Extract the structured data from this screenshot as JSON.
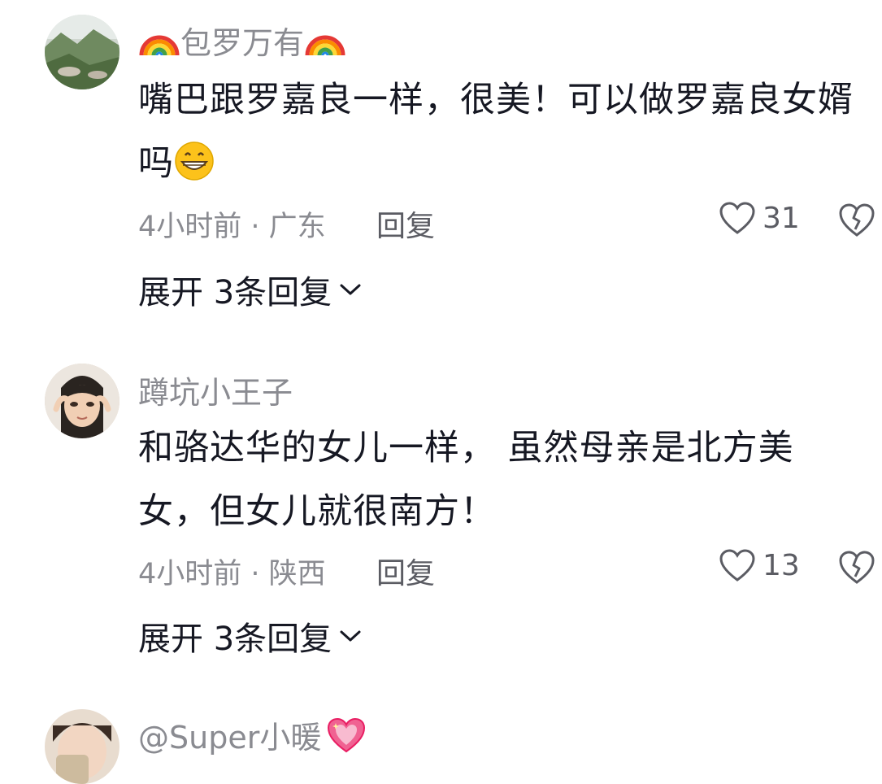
{
  "comments": [
    {
      "username": "包罗万有",
      "username_emoji": "rainbow-icon",
      "text": "嘴巴跟罗嘉良一样，很美！可以做罗嘉良女婿吗",
      "text_emoji": "grinning-face-icon",
      "time_location": "4小时前 · 广东",
      "reply_label": "回复",
      "like_count": "31",
      "expand_label": "展开 3条回复"
    },
    {
      "username": "蹲坑小王子",
      "text": "和骆达华的女儿一样， 虽然母亲是北方美女，但女儿就很南方！",
      "time_location": "4小时前 · 陕西",
      "reply_label": "回复",
      "like_count": "13",
      "expand_label": "展开 3条回复"
    },
    {
      "username": "@Super小暖",
      "username_emoji": "sparkling-heart-icon"
    }
  ],
  "colors": {
    "text_primary": "#161823",
    "text_secondary": "#8a8b91",
    "action": "#5b5c63"
  }
}
